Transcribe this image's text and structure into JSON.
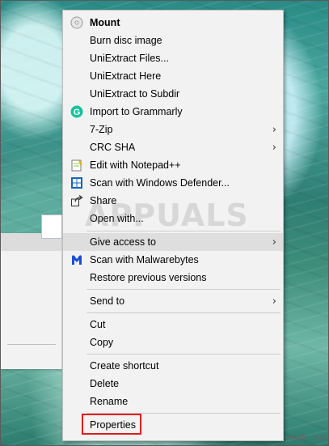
{
  "menu": {
    "items": [
      {
        "label": "Mount",
        "bold": true,
        "icon": "disc-icon"
      },
      {
        "label": "Burn disc image"
      },
      {
        "label": "UniExtract Files..."
      },
      {
        "label": "UniExtract Here"
      },
      {
        "label": "UniExtract to Subdir"
      },
      {
        "label": "Import to Grammarly",
        "icon": "grammarly-icon"
      },
      {
        "label": "7-Zip",
        "submenu": true
      },
      {
        "label": "CRC SHA",
        "submenu": true
      },
      {
        "label": "Edit with Notepad++",
        "icon": "notepadpp-icon"
      },
      {
        "label": "Scan with Windows Defender...",
        "icon": "windows-defender-icon"
      },
      {
        "label": "Share",
        "icon": "share-icon"
      },
      {
        "label": "Open with..."
      },
      {
        "label": "Give access to",
        "submenu": true,
        "highlighted": true
      },
      {
        "label": "Scan with Malwarebytes",
        "icon": "malwarebytes-icon"
      },
      {
        "label": "Restore previous versions"
      },
      {
        "label": "Send to",
        "submenu": true
      },
      {
        "label": "Cut"
      },
      {
        "label": "Copy"
      },
      {
        "label": "Create shortcut"
      },
      {
        "label": "Delete"
      },
      {
        "label": "Rename"
      },
      {
        "label": "Properties",
        "outlined": true
      }
    ]
  },
  "watermark": {
    "text": "APPUALS",
    "site": "wsxdn.com"
  },
  "colors": {
    "menu_bg": "#f2f2f2",
    "hover_bg": "#dedede",
    "outline_red": "#e01d1d",
    "grammarly_green": "#15c39a",
    "defender_blue": "#1565c0",
    "malwarebytes_blue": "#1a4ed8"
  }
}
